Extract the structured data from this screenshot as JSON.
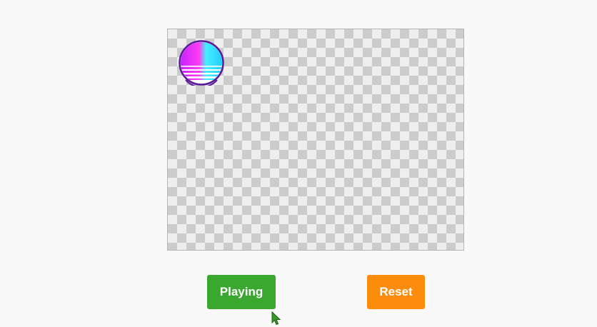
{
  "canvas": {
    "sprite_icon": "sunset-circle-icon",
    "checker_colors": {
      "light": "#eeeeee",
      "dark": "#cccccc"
    }
  },
  "controls": {
    "play_label": "Playing",
    "play_color": "#3aa72f",
    "reset_label": "Reset",
    "reset_color": "#fb8c0c"
  },
  "cursor": {
    "icon": "pointer-arrow-icon",
    "color": "#3a9a2a"
  }
}
